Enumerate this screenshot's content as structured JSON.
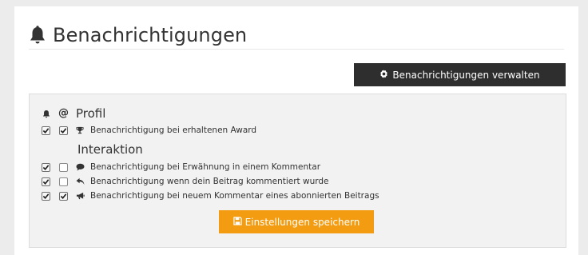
{
  "header": {
    "title": "Benachrichtigungen"
  },
  "manage_button": {
    "label": "Benachrichtigungen verwalten"
  },
  "columns": {
    "notify_symbol": "🔔",
    "mention_symbol": "@"
  },
  "sections": {
    "profil": {
      "title": "Profil",
      "rows": [
        {
          "label": "Benachrichtigung bei erhaltenen Award",
          "icon": "trophy-icon",
          "notify": true,
          "mail": true
        }
      ]
    },
    "interaktion": {
      "title": "Interaktion",
      "rows": [
        {
          "label": "Benachrichtigung bei Erwähnung in einem Kommentar",
          "icon": "comment-icon",
          "notify": true,
          "mail": false
        },
        {
          "label": "Benachrichtigung wenn dein Beitrag kommentiert wurde",
          "icon": "reply-icon",
          "notify": true,
          "mail": false
        },
        {
          "label": "Benachrichtigung bei neuem Kommentar eines abonnierten Beitrags",
          "icon": "bullhorn-icon",
          "notify": true,
          "mail": true
        }
      ]
    }
  },
  "save_button": {
    "label": "Einstellungen speichern"
  },
  "colors": {
    "accent": "#f39c12",
    "dark": "#2e2e2e",
    "panel": "#f2f2f2"
  }
}
